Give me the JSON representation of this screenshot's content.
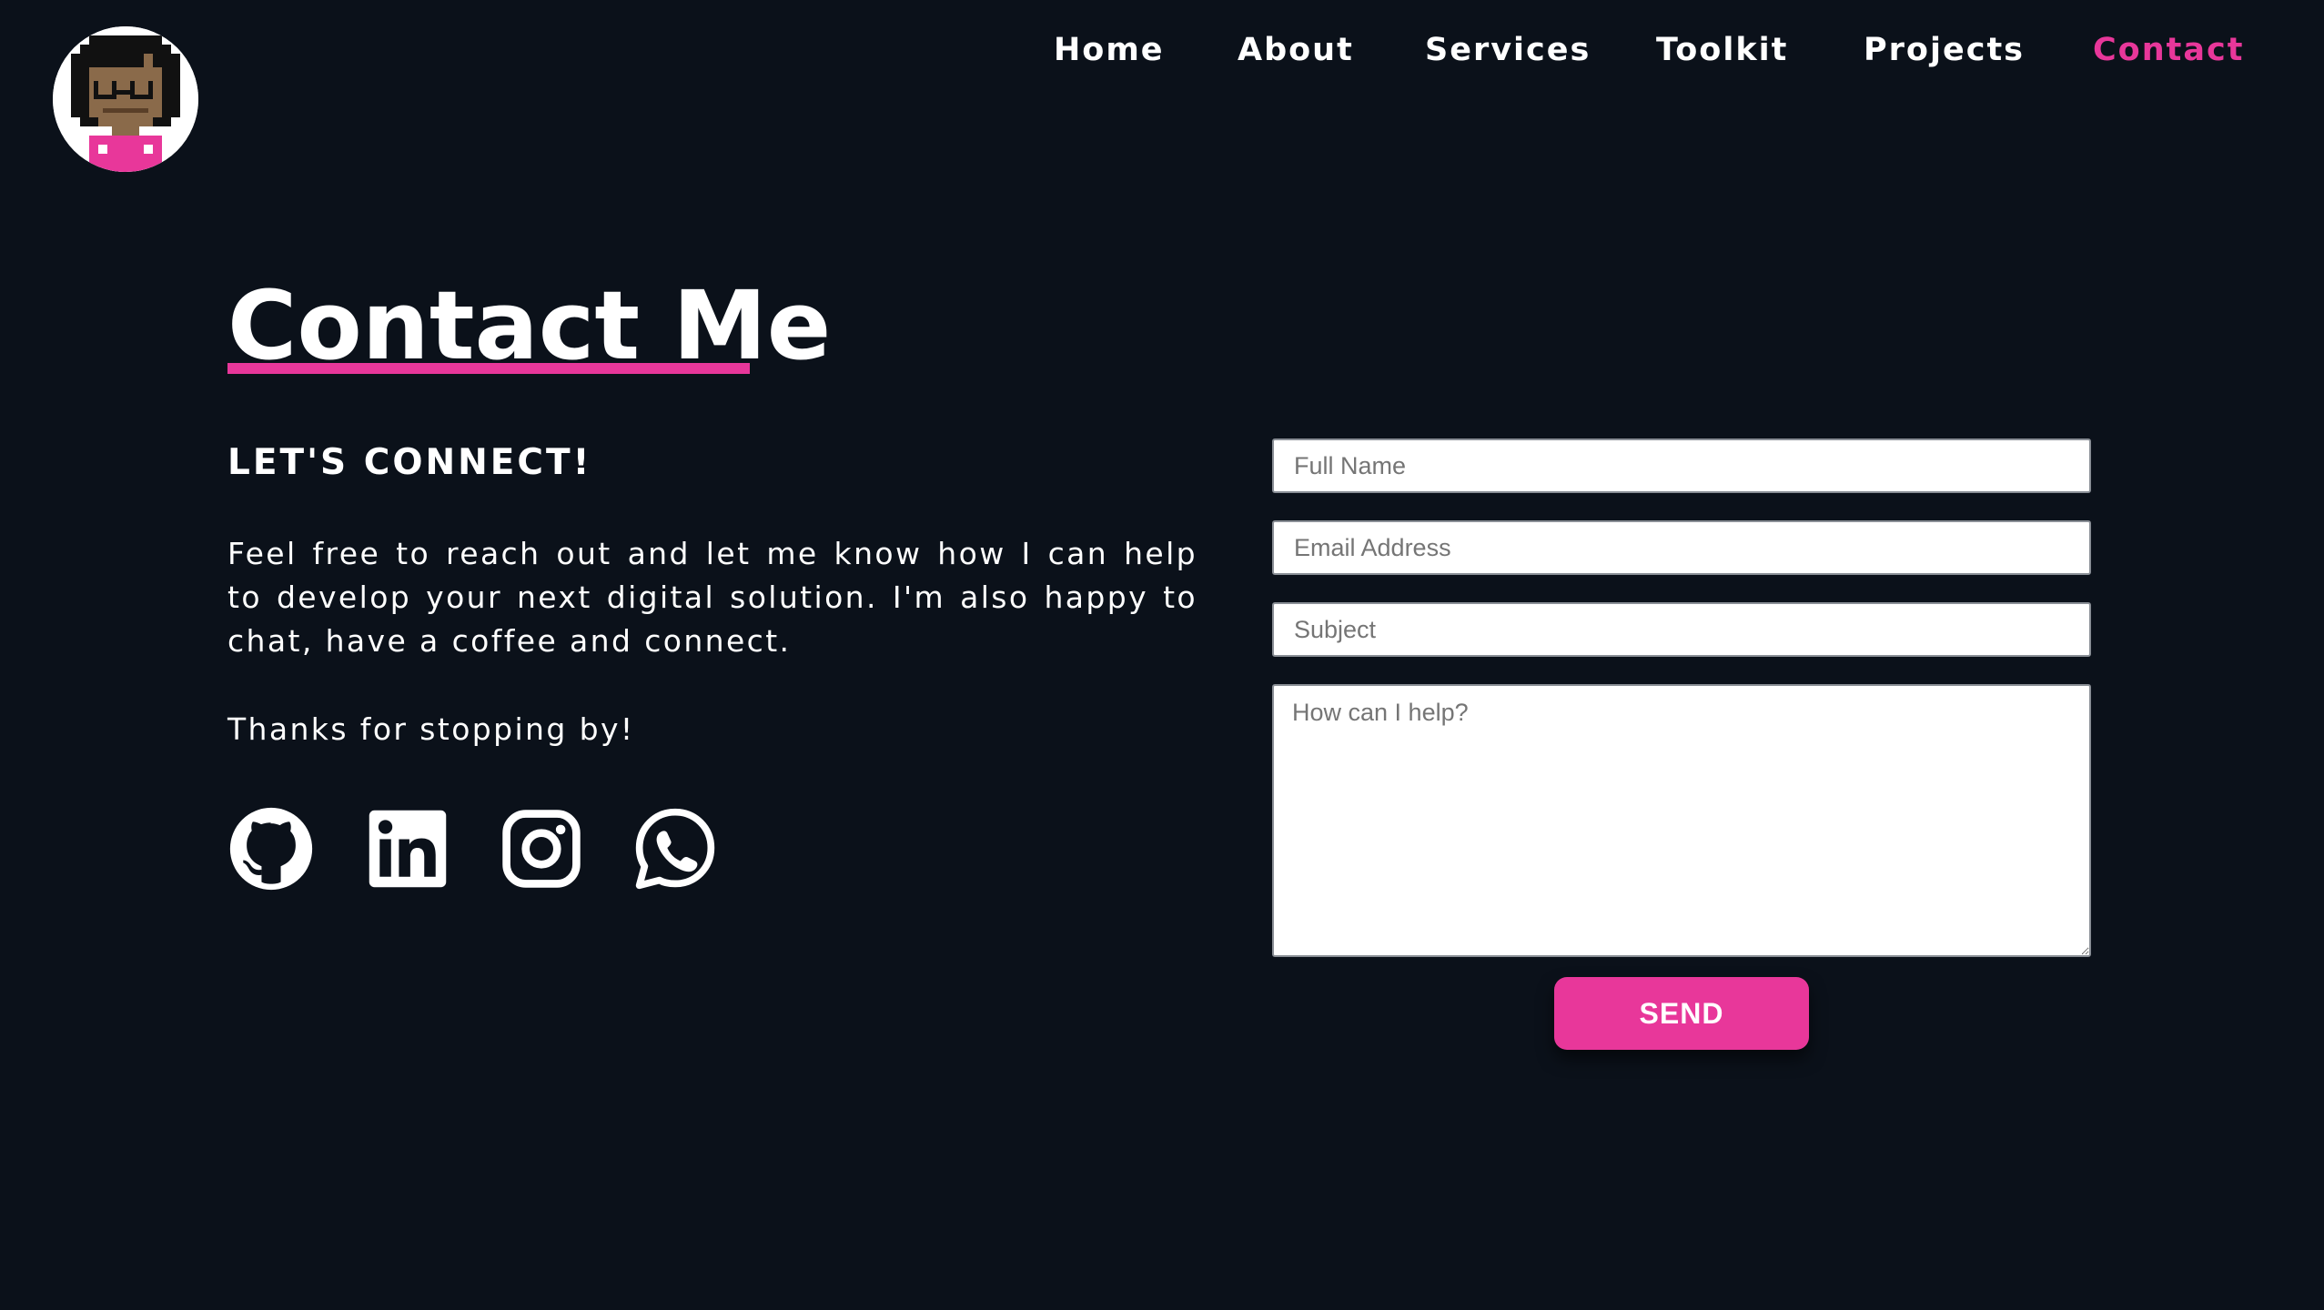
{
  "header": {
    "avatar_icon": "pixel-avatar-icon",
    "nav": [
      {
        "label": "Home"
      },
      {
        "label": "About"
      },
      {
        "label": "Services"
      },
      {
        "label": "Toolkit"
      },
      {
        "label": "Projects"
      },
      {
        "label": "Contact",
        "active": true
      }
    ]
  },
  "main": {
    "title": "Contact Me",
    "subtitle": "LET'S CONNECT!",
    "intro": "Feel free to reach out and let me know how I can help to develop your next digital solution. I'm also happy to chat, have a coffee and connect.",
    "thanks": "Thanks for stopping by!",
    "social": [
      {
        "icon": "github-icon"
      },
      {
        "icon": "linkedin-icon"
      },
      {
        "icon": "instagram-icon"
      },
      {
        "icon": "whatsapp-icon"
      }
    ]
  },
  "form": {
    "name_placeholder": "Full Name",
    "email_placeholder": "Email Address",
    "subject_placeholder": "Subject",
    "message_placeholder": "How can I help?",
    "send_label": "SEND"
  },
  "colors": {
    "background": "#0b111a",
    "accent": "#e8379a",
    "text": "#ffffff"
  }
}
